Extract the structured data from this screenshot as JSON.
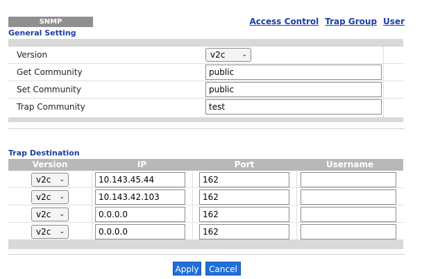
{
  "header": {
    "tab_label": "SNMP",
    "links": [
      "Access Control",
      "Trap Group",
      "User"
    ]
  },
  "general": {
    "title": "General Setting",
    "version_label": "Version",
    "version_value": "v2c",
    "get_label": "Get Community",
    "get_value": "public",
    "set_label": "Set Community",
    "set_value": "public",
    "trap_label": "Trap Community",
    "trap_value": "test"
  },
  "trap": {
    "title": "Trap Destination",
    "columns": [
      "Version",
      "IP",
      "Port",
      "Username"
    ],
    "rows": [
      {
        "version": "v2c",
        "ip": "10.143.45.44",
        "port": "162",
        "username": ""
      },
      {
        "version": "v2c",
        "ip": "10.143.42.103",
        "port": "162",
        "username": ""
      },
      {
        "version": "v2c",
        "ip": "0.0.0.0",
        "port": "162",
        "username": ""
      },
      {
        "version": "v2c",
        "ip": "0.0.0.0",
        "port": "162",
        "username": ""
      }
    ]
  },
  "buttons": {
    "apply": "Apply",
    "cancel": "Cancel"
  },
  "icons": {
    "dropdown": "chevron-down-icon"
  }
}
